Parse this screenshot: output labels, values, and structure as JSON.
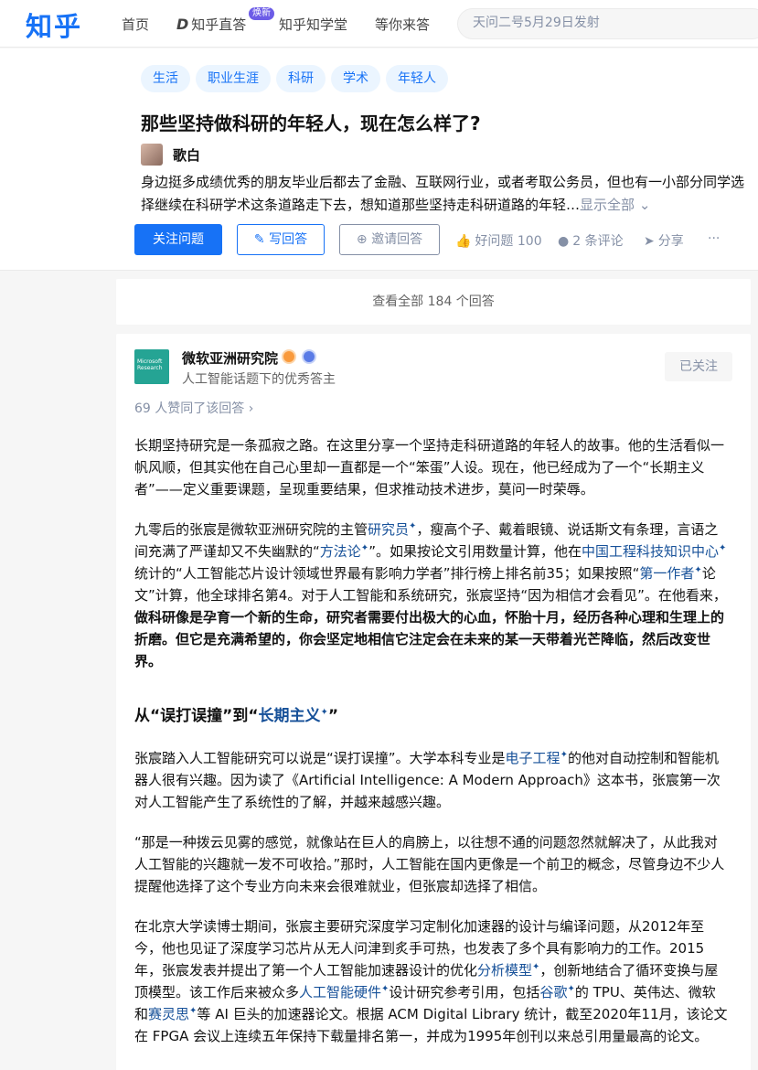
{
  "nav": {
    "logo": "知乎",
    "items": [
      "首页",
      "知乎直答",
      "知乎知学堂",
      "等你来答"
    ],
    "badge": "焕新",
    "search_placeholder": "天问二号5月29日发射"
  },
  "question": {
    "topics": [
      "生活",
      "职业生涯",
      "科研",
      "学术",
      "年轻人"
    ],
    "title": "那些坚持做科研的年轻人，现在怎么样了?",
    "asker": "歌白",
    "description": "身边挺多成绩优秀的朋友毕业后都去了金融、互联网行业，或者考取公务员，但也有一小部分同学选择继续在科研学术这条道路走下去，想知道那些坚持走科研道路的年轻…",
    "show_all": "显示全部",
    "actions": {
      "follow": "关注问题",
      "write": "写回答",
      "invite": "邀请回答",
      "good": "好问题 100",
      "comments": "2 条评论",
      "share": "分享",
      "more": "···"
    }
  },
  "view_all": "查看全部 184 个回答",
  "answer": {
    "author": "微软亚洲研究院",
    "avatar_text": "Microsoft Research",
    "bio": "人工智能话题下的优秀答主",
    "followed": "已关注",
    "upvotes": "69 人赞同了该回答 ›",
    "p1": "长期坚持研究是一条孤寂之路。在这里分享一个坚持走科研道路的年轻人的故事。他的生活看似一帆风顺，但其实他在自己心里却一直都是一个“笨蛋”人设。现在，他已经成为了一个“长期主义者”——定义重要课题，呈现重要结果，但求推动技术进步，莫问一时荣辱。",
    "p2": {
      "t1": "九零后的张宸是微软亚洲研究院的主管",
      "l1": "研究员",
      "t2": "，瘦高个子、戴着眼镜、说话斯文有条理，言语之间充满了严谨却又不失幽默的“",
      "l2": "方法论",
      "t3": "”。如果按论文引用数量计算，他在",
      "l3": "中国工程科技知识中心",
      "t4": "统计的“人工智能芯片设计领域世界最有影响力学者”排行榜上排名前35；如果按照“",
      "l4": "第一作者",
      "t5": "论文”计算，他全球排名第4。对于人工智能和系统研究，张宸坚持“因为相信才会看见”。在他看来，",
      "b1": "做科研像是孕育一个新的生命，研究者需要付出极大的心血，怀胎十月，经历各种心理和生理上的折磨。但它是充满希望的，你会坚定地相信它注定会在未来的某一天带着光芒降临，然后改变世界。"
    },
    "heading": {
      "t1": "从“误打误撞”到“",
      "l1": "长期主义",
      "t2": "”"
    },
    "p3": {
      "t1": "张宸踏入人工智能研究可以说是“误打误撞”。大学本科专业是",
      "l1": "电子工程",
      "t2": "的他对自动控制和智能机器人很有兴趣。因为读了《Artificial Intelligence: A Modern Approach》这本书，张宸第一次对人工智能产生了系统性的了解，并越来越感兴趣。"
    },
    "p4": "“那是一种拨云见雾的感觉，就像站在巨人的肩膀上，以往想不通的问题忽然就解决了，从此我对人工智能的兴趣就一发不可收拾。”那时，人工智能在国内更像是一个前卫的概念，尽管身边不少人提醒他选择了这个专业方向未来会很难就业，但张宸却选择了相信。",
    "p5": {
      "t1": "在北京大学读博士期间，张宸主要研究深度学习定制化加速器的设计与编译问题，从2012年至今，他也见证了深度学习芯片从无人问津到炙手可热，也发表了多个具有影响力的工作。2015 年，张宸发表并提出了第一个人工智能加速器设计的优化",
      "l1": "分析模型",
      "t2": "，创新地结合了循环变换与屋顶模型。该工作后来被众多",
      "l2": "人工智能硬件",
      "t3": "设计研究参考引用，包括",
      "l3": "谷歌",
      "t4": "的 TPU、英伟达、微软和",
      "l4": "赛灵思",
      "t5": "等 AI 巨头的加速器论文。根据 ACM Digital Library 统计，截至2020年11月，该论文在 FPGA 会议上连续五年保持下载量排名第一，并成为1995年创刊以来总引用量最高的论文。"
    },
    "spark": "✦"
  }
}
